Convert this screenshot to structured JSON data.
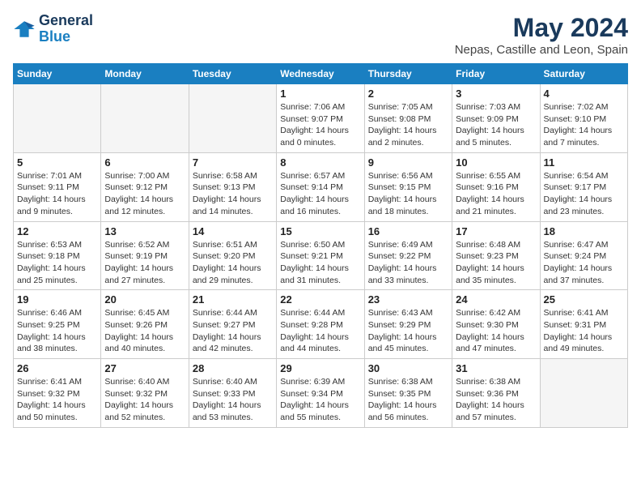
{
  "logo": {
    "line1": "General",
    "line2": "Blue"
  },
  "title": "May 2024",
  "subtitle": "Nepas, Castille and Leon, Spain",
  "days_of_week": [
    "Sunday",
    "Monday",
    "Tuesday",
    "Wednesday",
    "Thursday",
    "Friday",
    "Saturday"
  ],
  "weeks": [
    [
      {
        "day": "",
        "info": ""
      },
      {
        "day": "",
        "info": ""
      },
      {
        "day": "",
        "info": ""
      },
      {
        "day": "1",
        "info": "Sunrise: 7:06 AM\nSunset: 9:07 PM\nDaylight: 14 hours\nand 0 minutes."
      },
      {
        "day": "2",
        "info": "Sunrise: 7:05 AM\nSunset: 9:08 PM\nDaylight: 14 hours\nand 2 minutes."
      },
      {
        "day": "3",
        "info": "Sunrise: 7:03 AM\nSunset: 9:09 PM\nDaylight: 14 hours\nand 5 minutes."
      },
      {
        "day": "4",
        "info": "Sunrise: 7:02 AM\nSunset: 9:10 PM\nDaylight: 14 hours\nand 7 minutes."
      }
    ],
    [
      {
        "day": "5",
        "info": "Sunrise: 7:01 AM\nSunset: 9:11 PM\nDaylight: 14 hours\nand 9 minutes."
      },
      {
        "day": "6",
        "info": "Sunrise: 7:00 AM\nSunset: 9:12 PM\nDaylight: 14 hours\nand 12 minutes."
      },
      {
        "day": "7",
        "info": "Sunrise: 6:58 AM\nSunset: 9:13 PM\nDaylight: 14 hours\nand 14 minutes."
      },
      {
        "day": "8",
        "info": "Sunrise: 6:57 AM\nSunset: 9:14 PM\nDaylight: 14 hours\nand 16 minutes."
      },
      {
        "day": "9",
        "info": "Sunrise: 6:56 AM\nSunset: 9:15 PM\nDaylight: 14 hours\nand 18 minutes."
      },
      {
        "day": "10",
        "info": "Sunrise: 6:55 AM\nSunset: 9:16 PM\nDaylight: 14 hours\nand 21 minutes."
      },
      {
        "day": "11",
        "info": "Sunrise: 6:54 AM\nSunset: 9:17 PM\nDaylight: 14 hours\nand 23 minutes."
      }
    ],
    [
      {
        "day": "12",
        "info": "Sunrise: 6:53 AM\nSunset: 9:18 PM\nDaylight: 14 hours\nand 25 minutes."
      },
      {
        "day": "13",
        "info": "Sunrise: 6:52 AM\nSunset: 9:19 PM\nDaylight: 14 hours\nand 27 minutes."
      },
      {
        "day": "14",
        "info": "Sunrise: 6:51 AM\nSunset: 9:20 PM\nDaylight: 14 hours\nand 29 minutes."
      },
      {
        "day": "15",
        "info": "Sunrise: 6:50 AM\nSunset: 9:21 PM\nDaylight: 14 hours\nand 31 minutes."
      },
      {
        "day": "16",
        "info": "Sunrise: 6:49 AM\nSunset: 9:22 PM\nDaylight: 14 hours\nand 33 minutes."
      },
      {
        "day": "17",
        "info": "Sunrise: 6:48 AM\nSunset: 9:23 PM\nDaylight: 14 hours\nand 35 minutes."
      },
      {
        "day": "18",
        "info": "Sunrise: 6:47 AM\nSunset: 9:24 PM\nDaylight: 14 hours\nand 37 minutes."
      }
    ],
    [
      {
        "day": "19",
        "info": "Sunrise: 6:46 AM\nSunset: 9:25 PM\nDaylight: 14 hours\nand 38 minutes."
      },
      {
        "day": "20",
        "info": "Sunrise: 6:45 AM\nSunset: 9:26 PM\nDaylight: 14 hours\nand 40 minutes."
      },
      {
        "day": "21",
        "info": "Sunrise: 6:44 AM\nSunset: 9:27 PM\nDaylight: 14 hours\nand 42 minutes."
      },
      {
        "day": "22",
        "info": "Sunrise: 6:44 AM\nSunset: 9:28 PM\nDaylight: 14 hours\nand 44 minutes."
      },
      {
        "day": "23",
        "info": "Sunrise: 6:43 AM\nSunset: 9:29 PM\nDaylight: 14 hours\nand 45 minutes."
      },
      {
        "day": "24",
        "info": "Sunrise: 6:42 AM\nSunset: 9:30 PM\nDaylight: 14 hours\nand 47 minutes."
      },
      {
        "day": "25",
        "info": "Sunrise: 6:41 AM\nSunset: 9:31 PM\nDaylight: 14 hours\nand 49 minutes."
      }
    ],
    [
      {
        "day": "26",
        "info": "Sunrise: 6:41 AM\nSunset: 9:32 PM\nDaylight: 14 hours\nand 50 minutes."
      },
      {
        "day": "27",
        "info": "Sunrise: 6:40 AM\nSunset: 9:32 PM\nDaylight: 14 hours\nand 52 minutes."
      },
      {
        "day": "28",
        "info": "Sunrise: 6:40 AM\nSunset: 9:33 PM\nDaylight: 14 hours\nand 53 minutes."
      },
      {
        "day": "29",
        "info": "Sunrise: 6:39 AM\nSunset: 9:34 PM\nDaylight: 14 hours\nand 55 minutes."
      },
      {
        "day": "30",
        "info": "Sunrise: 6:38 AM\nSunset: 9:35 PM\nDaylight: 14 hours\nand 56 minutes."
      },
      {
        "day": "31",
        "info": "Sunrise: 6:38 AM\nSunset: 9:36 PM\nDaylight: 14 hours\nand 57 minutes."
      },
      {
        "day": "",
        "info": ""
      }
    ]
  ]
}
